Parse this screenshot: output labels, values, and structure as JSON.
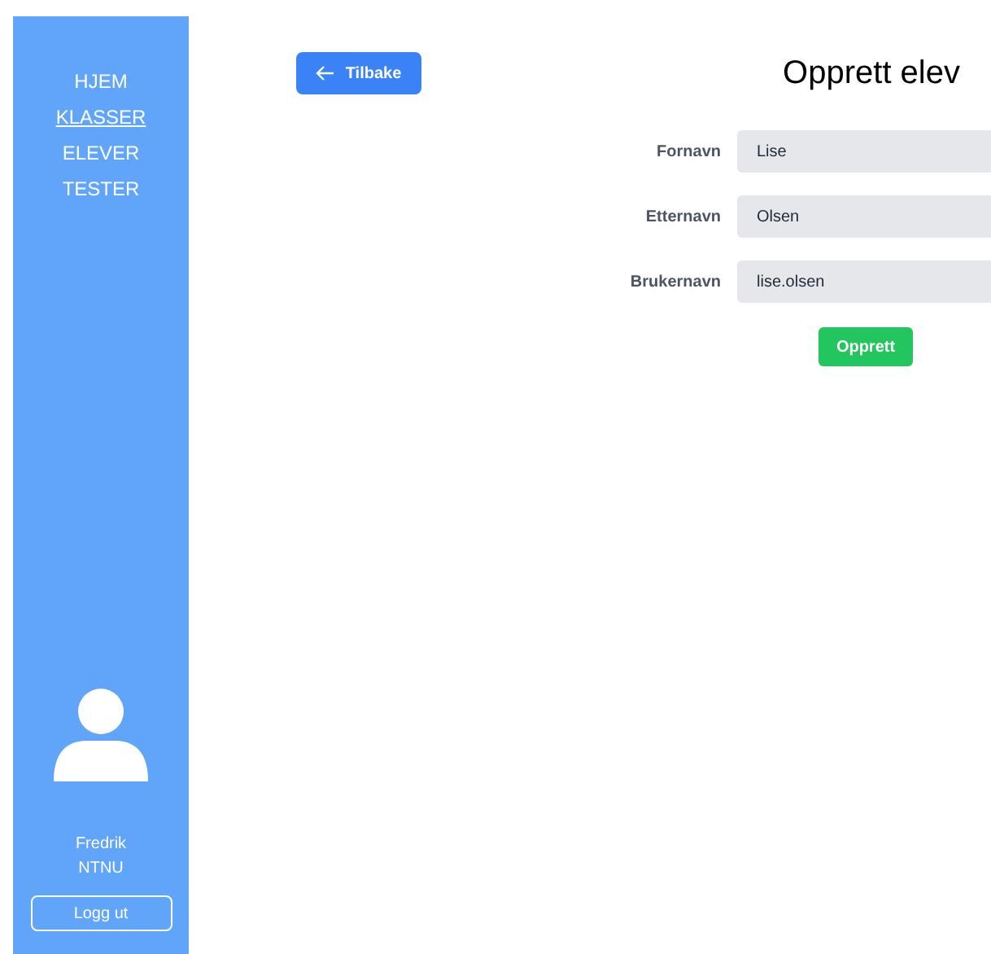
{
  "sidebar": {
    "nav_items": [
      {
        "label": "HJEM",
        "selected": false
      },
      {
        "label": "KLASSER",
        "selected": true
      },
      {
        "label": "ELEVER",
        "selected": false
      },
      {
        "label": "TESTER",
        "selected": false
      }
    ],
    "user": {
      "name": "Fredrik",
      "organization": "NTNU"
    },
    "logout_button": "Logg ut"
  },
  "back_button": "Tilbake",
  "title": "Opprett elev",
  "form": {
    "fields": [
      {
        "label": "Fornavn",
        "value": "Lise"
      },
      {
        "label": "Etternavn",
        "value": "Olsen"
      },
      {
        "label": "Brukernavn",
        "value": "lise.olsen"
      }
    ],
    "submit_button": "Opprett"
  }
}
